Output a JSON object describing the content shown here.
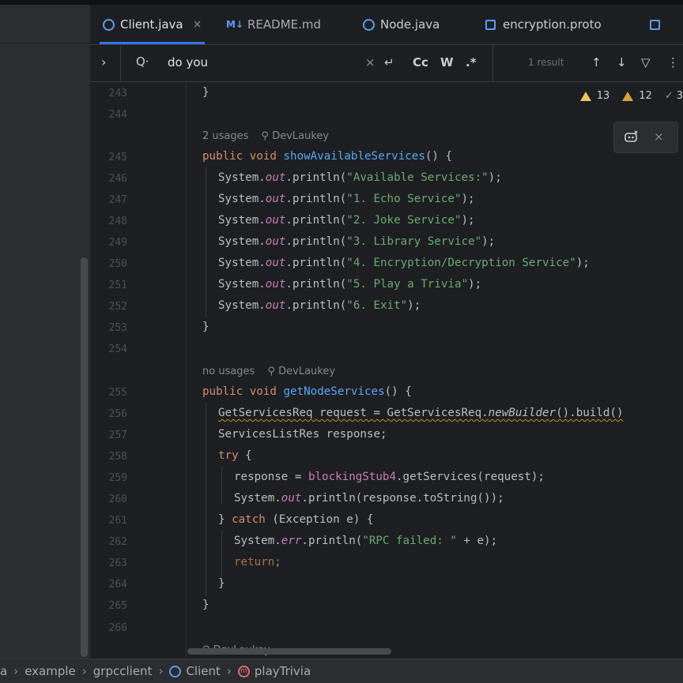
{
  "tabs": [
    {
      "label": "Client.java",
      "icon": "class-icon",
      "active": true
    },
    {
      "label": "README.md",
      "icon": "markdown-icon",
      "prefix": "M↓"
    },
    {
      "label": "Node.java",
      "icon": "class-icon"
    },
    {
      "label": "encryption.proto",
      "icon": "proto-file-icon"
    }
  ],
  "find": {
    "query": "do you",
    "result": "1 result",
    "case_label": "Cc",
    "word_label": "W",
    "regex_label": ".*"
  },
  "inspections": {
    "warnings": "13",
    "weak_warnings": "12",
    "ok": "3"
  },
  "lines": {
    "l243": "243",
    "l244": "244",
    "l245": "245",
    "l246": "246",
    "l247": "247",
    "l248": "248",
    "l249": "249",
    "l250": "250",
    "l251": "251",
    "l252": "252",
    "l253": "253",
    "l254": "254",
    "l255": "255",
    "l256": "256",
    "l257": "257",
    "l258": "258",
    "l259": "259",
    "l260": "260",
    "l261": "261",
    "l262": "262",
    "l263": "263",
    "l264": "264",
    "l265": "265",
    "l266": "266"
  },
  "hints": {
    "h1_usages": "2 usages",
    "h1_author": "DevLaukey",
    "h2_usages": "no usages",
    "h2_author": "DevLaukey",
    "h3_author": "DevLaukey"
  },
  "code": {
    "brace_close": "}",
    "public_void": "public void",
    "showAvailableServices": "showAvailableServices",
    "getNodeServices": "getNodeServices",
    "sig_end": "() {",
    "system": "System.",
    "out": "out",
    "err": "err",
    "println_open": ".println(",
    "println_close": ");",
    "s246": "\"Available Services:\"",
    "s247": "\"1. Echo Service\"",
    "s248": "\"2. Joke Service\"",
    "s249": "\"3. Library Service\"",
    "s250": "\"4. Encryption/Decryption Service\"",
    "s251": "\"5. Play a Trivia\"",
    "s252": "\"6. Exit\"",
    "c256a": "GetServicesReq request = GetServicesReq.",
    "c256b": "newBuilder",
    "c256c": "().build()",
    "c257": "ServicesListRes response;",
    "try": "try",
    "open_brace": " {",
    "c259a": "response = ",
    "c259b": "blockingStub4",
    "c259c": ".getServices(request);",
    "c260b": ".println(response.toString());",
    "c261a": "} ",
    "catch": "catch",
    "c261b": " (Exception e) {",
    "s262": "\"RPC failed: \"",
    "c262b": " + e);",
    "return": "return",
    "semi": ";"
  },
  "breadcrumbs": {
    "b1": "a",
    "b2": "example",
    "b3": "grpcclient",
    "b4": "Client",
    "b5": "playTrivia"
  },
  "colors": {
    "accent": "#3574f0",
    "keyword": "#cf8e6d",
    "function": "#56a8f5",
    "string": "#6aab73",
    "field": "#c77dbb"
  }
}
